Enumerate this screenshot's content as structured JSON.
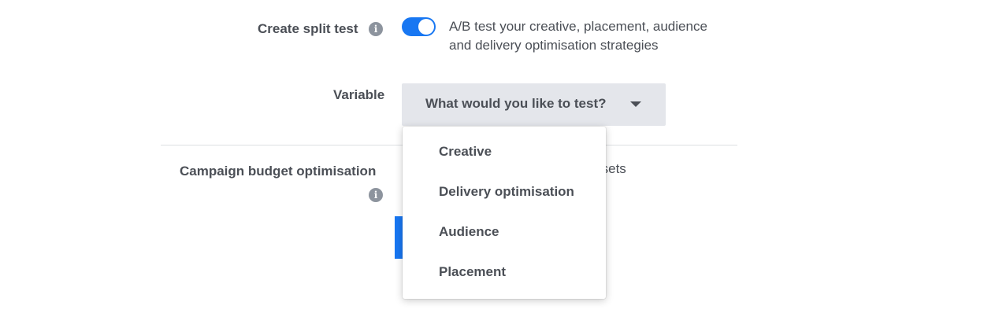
{
  "split_test": {
    "label": "Create split test",
    "info_icon": "info-icon",
    "toggle_on": true,
    "description_line1": "A/B test your creative, placement, audience",
    "description_line2": "and delivery optimisation strategies"
  },
  "variable": {
    "label": "Variable",
    "select_label": "What would you like to test?",
    "caret_icon": "caret-down-icon",
    "options": [
      "Creative",
      "Delivery optimisation",
      "Audience",
      "Placement"
    ]
  },
  "budget": {
    "label": "Campaign budget optimisation",
    "info_icon": "info-icon",
    "partial_text": "ad sets"
  },
  "colors": {
    "accent": "#1877f2",
    "text": "#4b4f56",
    "select_bg": "#e4e6eb"
  }
}
